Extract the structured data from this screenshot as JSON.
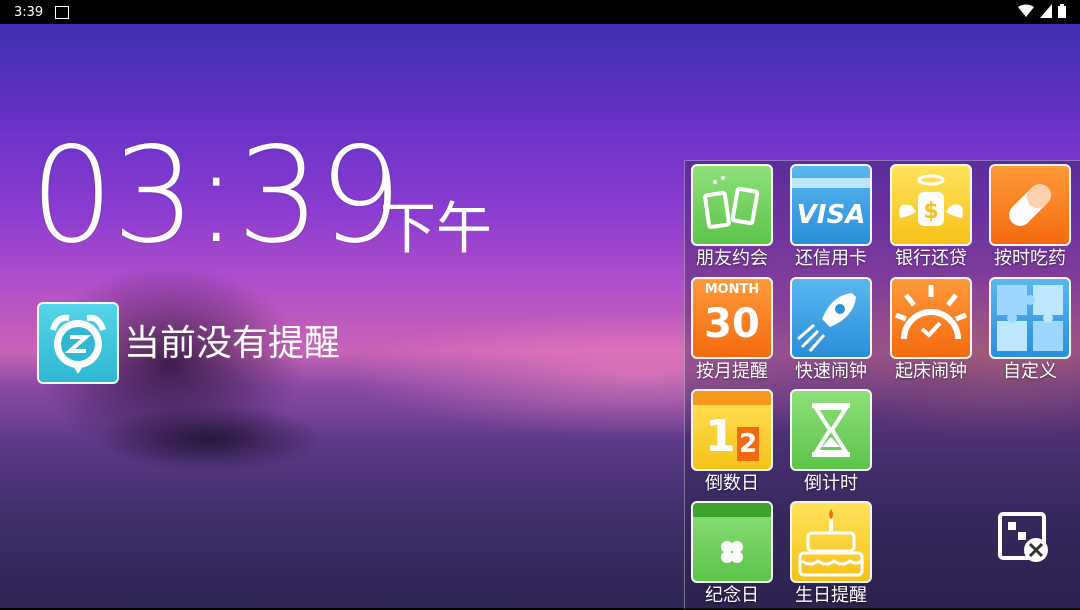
{
  "status_bar": {
    "time": "3:39"
  },
  "clock": {
    "time": "03:39",
    "ampm": "下午"
  },
  "reminder": {
    "text": "当前没有提醒"
  },
  "tiles": [
    {
      "label": "朋友约会",
      "icon": "drinks-icon",
      "color": "green"
    },
    {
      "label": "还信用卡",
      "icon": "visa-card-icon",
      "color": "blue",
      "badge": "VISA"
    },
    {
      "label": "银行还贷",
      "icon": "money-bag-icon",
      "color": "yellow"
    },
    {
      "label": "按时吃药",
      "icon": "pill-icon",
      "color": "orange"
    },
    {
      "label": "按月提醒",
      "icon": "month-calendar-icon",
      "color": "orange",
      "badge_top": "MONTH",
      "badge_num": "30"
    },
    {
      "label": "快速闹钟",
      "icon": "rocket-icon",
      "color": "blue"
    },
    {
      "label": "起床闹钟",
      "icon": "sunrise-icon",
      "color": "orange"
    },
    {
      "label": "自定义",
      "icon": "puzzle-icon",
      "color": "blue"
    },
    {
      "label": "倒数日",
      "icon": "countdown-calendar-icon",
      "color": "yellow",
      "badge_num1": "1",
      "badge_num2": "2"
    },
    {
      "label": "倒计时",
      "icon": "hourglass-icon",
      "color": "green"
    },
    {
      "label": "纪念日",
      "icon": "clover-calendar-icon",
      "color": "green"
    },
    {
      "label": "生日提醒",
      "icon": "birthday-cake-icon",
      "color": "yellow"
    }
  ]
}
